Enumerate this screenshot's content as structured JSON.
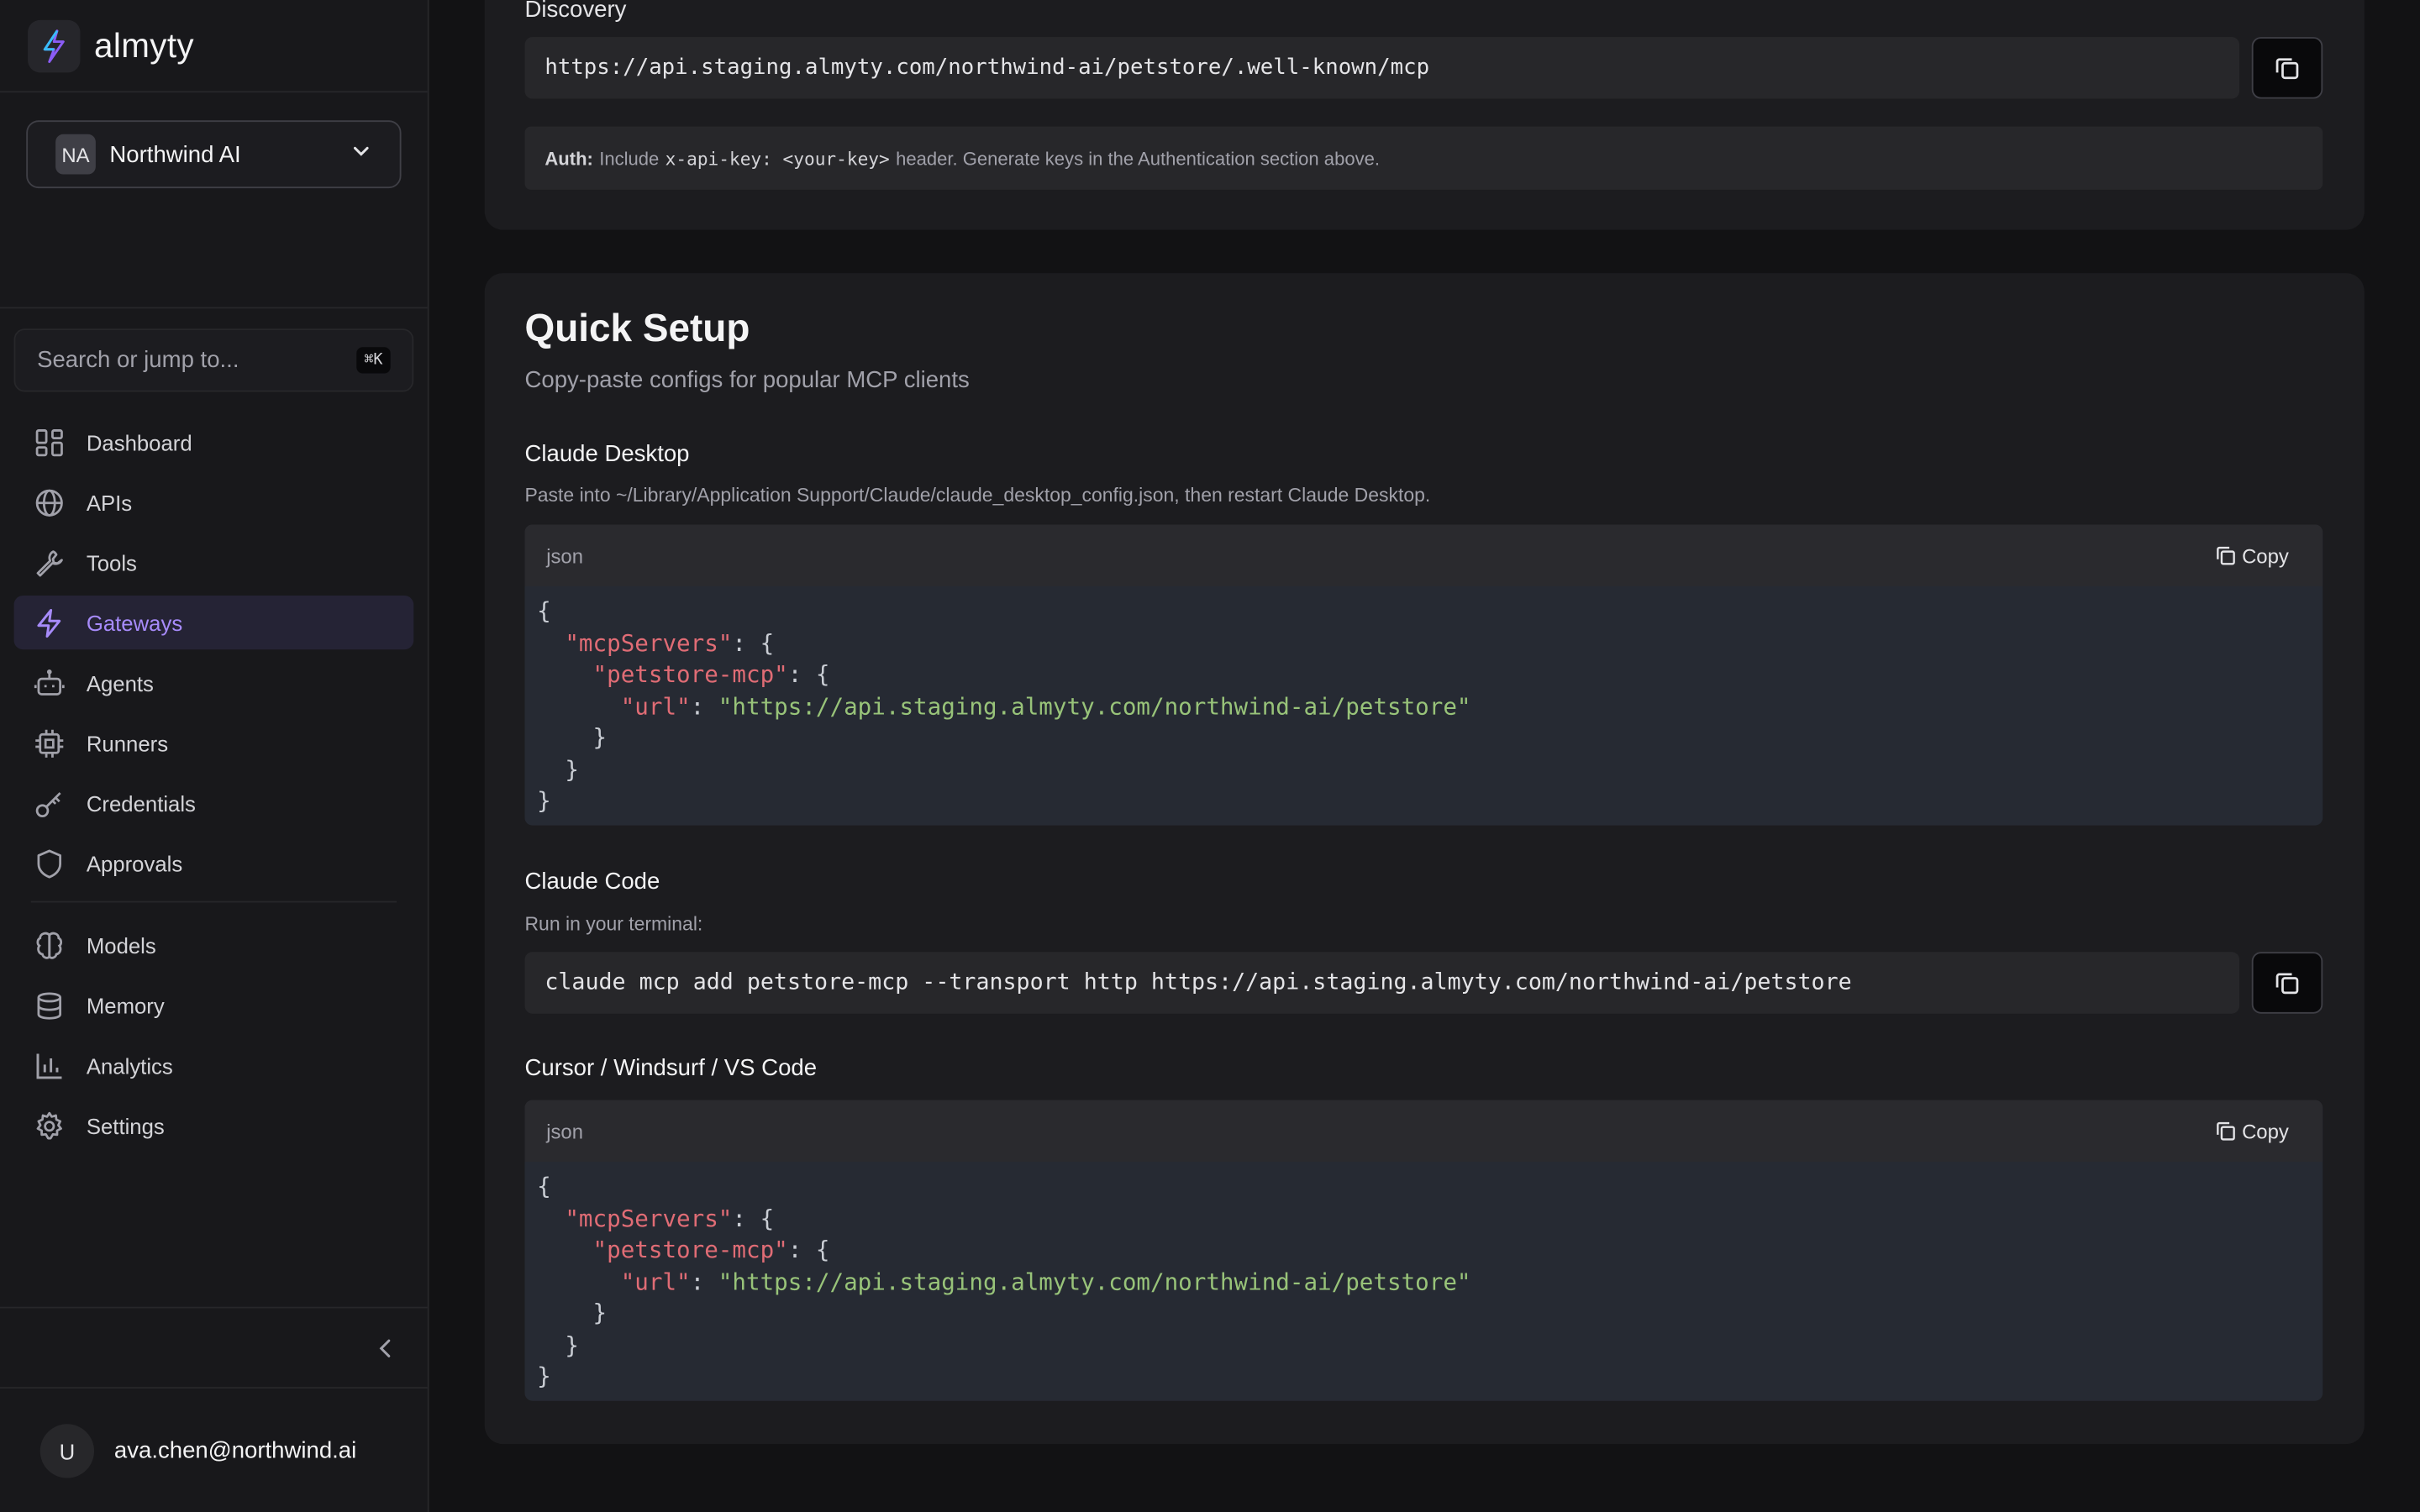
{
  "brand": {
    "name": "almyty"
  },
  "org": {
    "initials": "NA",
    "name": "Northwind AI"
  },
  "search": {
    "placeholder": "Search or jump to...",
    "shortcut": "⌘K"
  },
  "nav": {
    "primary": [
      {
        "label": "Dashboard",
        "icon": "dashboard-icon"
      },
      {
        "label": "APIs",
        "icon": "globe-icon"
      },
      {
        "label": "Tools",
        "icon": "wrench-icon"
      },
      {
        "label": "Gateways",
        "icon": "bolt-icon",
        "active": true
      },
      {
        "label": "Agents",
        "icon": "bot-icon"
      },
      {
        "label": "Runners",
        "icon": "cpu-icon"
      },
      {
        "label": "Credentials",
        "icon": "key-icon"
      },
      {
        "label": "Approvals",
        "icon": "shield-icon"
      }
    ],
    "secondary": [
      {
        "label": "Models",
        "icon": "brain-icon"
      },
      {
        "label": "Memory",
        "icon": "database-icon"
      },
      {
        "label": "Analytics",
        "icon": "bar-chart-icon"
      },
      {
        "label": "Settings",
        "icon": "gear-icon"
      }
    ]
  },
  "user": {
    "initial": "U",
    "email": "ava.chen@northwind.ai"
  },
  "discovery": {
    "label": "Discovery",
    "url": "https://api.staging.almyty.com/northwind-ai/petstore/.well-known/mcp",
    "auth_label": "Auth:",
    "auth_pre": "Include",
    "auth_code": "x-api-key: <your-key>",
    "auth_post": "header. Generate keys in the Authentication section above."
  },
  "quick_setup": {
    "title": "Quick Setup",
    "subtitle": "Copy-paste configs for popular MCP clients",
    "copy_label": "Copy",
    "claude_desktop": {
      "title": "Claude Desktop",
      "desc": "Paste into ~/Library/Application Support/Claude/claude_desktop_config.json, then restart Claude Desktop.",
      "lang": "json",
      "servers_key": "\"mcpServers\"",
      "server_name": "\"petstore-mcp\"",
      "url_key": "\"url\"",
      "url_value": "\"https://api.staging.almyty.com/northwind-ai/petstore\""
    },
    "claude_code": {
      "title": "Claude Code",
      "desc": "Run in your terminal:",
      "command": "claude mcp add petstore-mcp --transport http https://api.staging.almyty.com/northwind-ai/petstore"
    },
    "cursor": {
      "title": "Cursor / Windsurf / VS Code",
      "lang": "json",
      "servers_key": "\"mcpServers\"",
      "server_name": "\"petstore-mcp\"",
      "url_key": "\"url\"",
      "url_value": "\"https://api.staging.almyty.com/northwind-ai/petstore\""
    }
  },
  "colors": {
    "accent": "#a78bfa",
    "json_key": "#e06c75",
    "json_string": "#98c379"
  }
}
